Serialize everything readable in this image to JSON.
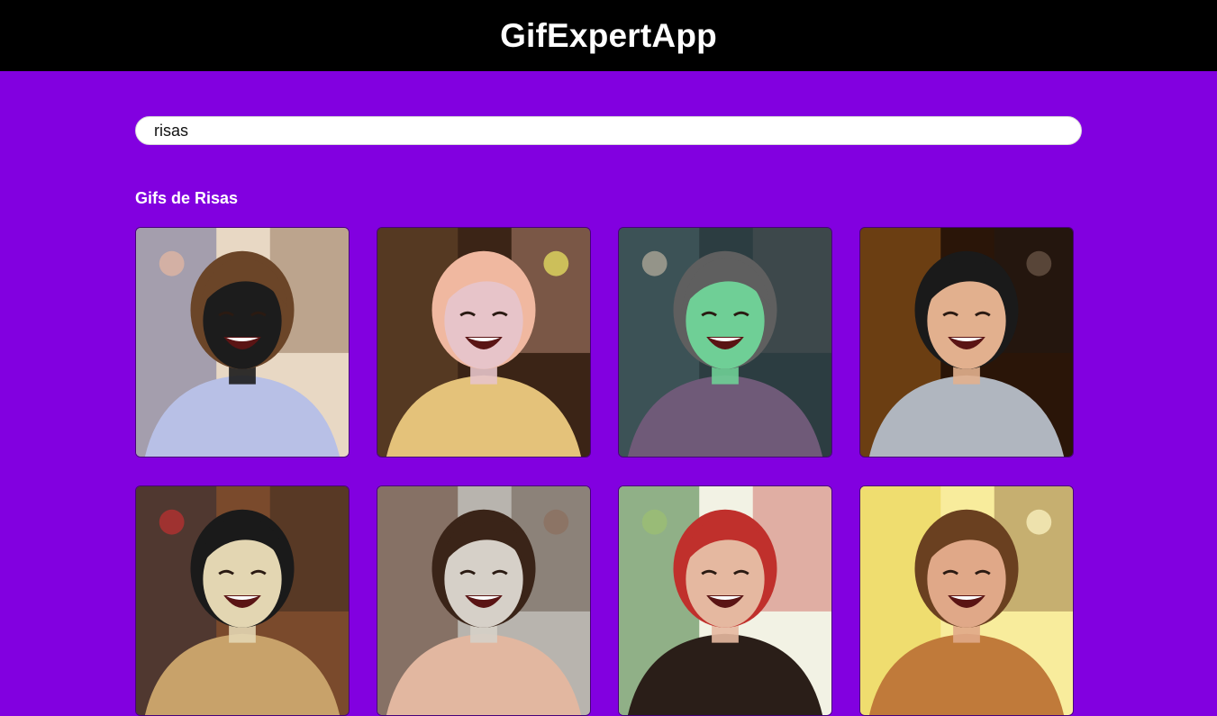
{
  "header": {
    "title": "GifExpertApp"
  },
  "search": {
    "value": "risas"
  },
  "category": {
    "title": "Gifs de Risas"
  },
  "gifs": [
    {
      "name": "gif-office-man-laughing",
      "palette": [
        "#e8d8c4",
        "#6c6f9a",
        "#b8c0e6",
        "#1c1c1c",
        "#e7b8a0",
        "#6b4528"
      ]
    },
    {
      "name": "gif-blonde-woman-laughing",
      "palette": [
        "#3b2416",
        "#6c4a2d",
        "#e4c27a",
        "#e7c4c9",
        "#f0eb63",
        "#f0b8a0"
      ]
    },
    {
      "name": "gif-cartoon-friends-laughing",
      "palette": [
        "#2c3d41",
        "#4a6468",
        "#6f5a78",
        "#6fcf96",
        "#b9b0a0",
        "#5f5f5f"
      ]
    },
    {
      "name": "gif-woman-glasses-laughing",
      "palette": [
        "#2a1508",
        "#a0601c",
        "#b0b6bf",
        "#e2b08e",
        "#6f5a4a",
        "#1a1a1a"
      ]
    },
    {
      "name": "gif-man-room-posters",
      "palette": [
        "#7a4a2c",
        "#2e2a34",
        "#c8a26a",
        "#e3d6b2",
        "#c03030",
        "#1a1a1a"
      ]
    },
    {
      "name": "gif-woman-brown-hair-laughing",
      "palette": [
        "#b8b4ae",
        "#5c3a2a",
        "#e2b7a0",
        "#d6d0c8",
        "#8b6e5c",
        "#3a2418"
      ]
    },
    {
      "name": "gif-woman-palm-trees",
      "palette": [
        "#f2f2e4",
        "#3f7a3a",
        "#2a1e18",
        "#e5b8a0",
        "#9cc070",
        "#c0302c"
      ]
    },
    {
      "name": "gif-man-bright-yellow",
      "palette": [
        "#f8ec9c",
        "#e8d24a",
        "#c07a3a",
        "#e0a888",
        "#fff8c8",
        "#6a4020"
      ]
    }
  ]
}
